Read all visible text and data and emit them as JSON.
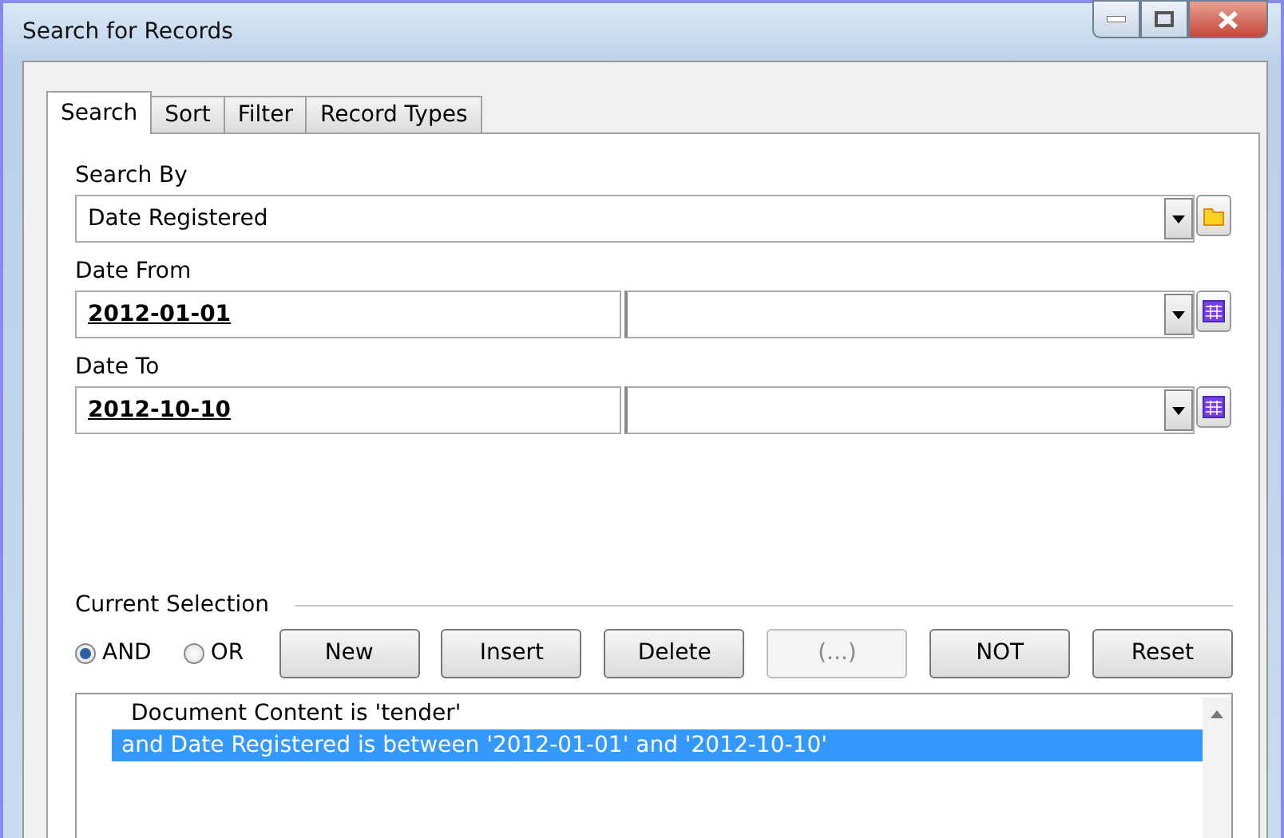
{
  "window": {
    "title": "Search for Records"
  },
  "tabs": [
    {
      "label": "Search",
      "selected": true
    },
    {
      "label": "Sort",
      "selected": false
    },
    {
      "label": "Filter",
      "selected": false
    },
    {
      "label": "Record Types",
      "selected": false
    }
  ],
  "search_by": {
    "label": "Search By",
    "value": "Date Registered"
  },
  "date_fields": [
    {
      "label": "Date From",
      "value": "2012-01-01"
    },
    {
      "label": "Date To",
      "value": "2012-10-10"
    }
  ],
  "current_selection": {
    "label": "Current Selection",
    "operators": [
      {
        "label": "AND",
        "selected": true
      },
      {
        "label": "OR",
        "selected": false
      }
    ],
    "buttons": [
      {
        "label": "New",
        "disabled": false
      },
      {
        "label": "Insert",
        "disabled": false
      },
      {
        "label": "Delete",
        "disabled": false
      },
      {
        "label": "(...)",
        "disabled": true
      },
      {
        "label": "NOT",
        "disabled": false
      },
      {
        "label": "Reset",
        "disabled": false
      }
    ],
    "items": [
      {
        "text": "Document Content is 'tender'",
        "selected": false
      },
      {
        "text": "and Date Registered is between '2012-01-01' and '2012-10-10'",
        "selected": true
      }
    ]
  }
}
